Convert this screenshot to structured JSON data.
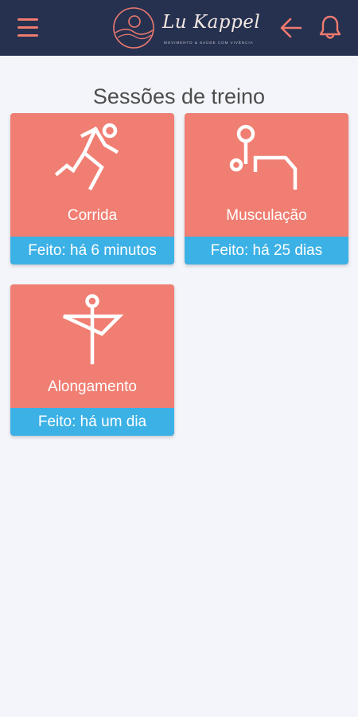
{
  "header": {
    "brand_name": "Lu Kappel",
    "brand_tagline": "movimento & saúde com vivência",
    "colors": {
      "bar": "#263150",
      "accent": "#ef7a6e"
    },
    "icons": {
      "menu": "hamburger-menu-icon",
      "back": "arrow-left-icon",
      "notifications": "bell-icon"
    }
  },
  "page": {
    "title": "Sessões de treino"
  },
  "sessions": [
    {
      "name": "Corrida",
      "status": "Feito: há 6 minutos",
      "icon": "runner-icon"
    },
    {
      "name": "Musculação",
      "status": "Feito: há 25 dias",
      "icon": "weightlifting-icon"
    },
    {
      "name": "Alongamento",
      "status": "Feito: há um dia",
      "icon": "stretching-icon"
    }
  ],
  "colors": {
    "card": "#f07e72",
    "status_bar": "#3cb1e6",
    "background": "#f4f5fa"
  }
}
